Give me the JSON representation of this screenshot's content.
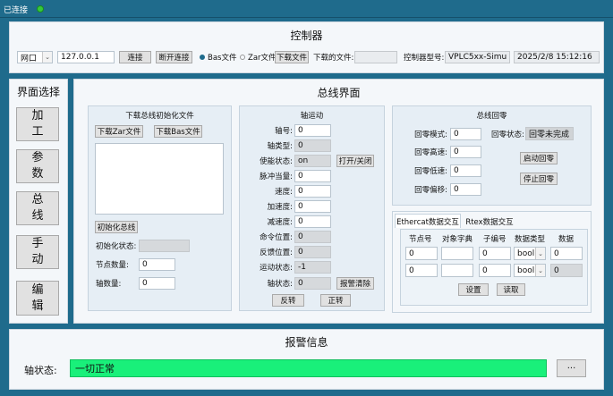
{
  "top": {
    "status": "已连接"
  },
  "controller": {
    "title": "控制器",
    "net_option": "网口",
    "ip": "127.0.0.1",
    "connect": "连接",
    "disconnect": "断开连接",
    "bas_file": "Bas文件",
    "zar_file": "Zar文件",
    "download_file": "下载文件",
    "downloaded_label": "下载的文件:",
    "downloaded_value": "",
    "model_label": "控制器型号:",
    "model_value": "VPLC5xx-Simu",
    "datetime": "2025/2/8 15:12:16"
  },
  "nav": {
    "title": "界面选择",
    "items": [
      "加\n工",
      "参\n数",
      "总\n线",
      "手\n动",
      "编\n辑"
    ]
  },
  "bus": {
    "title": "总线界面",
    "init": {
      "title": "下载总线初始化文件",
      "download_zar": "下载Zar文件",
      "download_bas": "下载Bas文件",
      "init_bus": "初始化总线",
      "init_state_label": "初始化状态:",
      "init_state_value": "",
      "node_count_label": "节点数量:",
      "node_count_value": "0",
      "axis_count_label": "轴数量:",
      "axis_count_value": "0"
    },
    "axis": {
      "title": "轴运动",
      "axis_no_label": "轴号:",
      "axis_no_value": "0",
      "axis_type_label": "轴类型:",
      "axis_type_value": "0",
      "enable_label": "使能状态:",
      "enable_value": "on",
      "toggle": "打开/关闭",
      "pulse_label": "脉冲当量:",
      "pulse_value": "0",
      "speed_label": "速度:",
      "speed_value": "0",
      "accel_label": "加速度:",
      "accel_value": "0",
      "decel_label": "减速度:",
      "decel_value": "0",
      "cmd_pos_label": "命令位置:",
      "cmd_pos_value": "0",
      "fb_pos_label": "反馈位置:",
      "fb_pos_value": "0",
      "motion_label": "运动状态:",
      "motion_value": "-1",
      "axis_state_label": "轴状态:",
      "axis_state_value": "0",
      "clear_alarm": "报警清除",
      "reverse": "反转",
      "forward": "正转"
    },
    "homing": {
      "title": "总线回零",
      "mode_label": "回零模式:",
      "mode_value": "0",
      "state_label": "回零状态:",
      "state_value": "回零未完成",
      "high_label": "回零高速:",
      "high_value": "0",
      "start": "启动回零",
      "low_label": "回零低速:",
      "low_value": "0",
      "stop": "停止回零",
      "offset_label": "回零偏移:",
      "offset_value": "0"
    },
    "tabs": [
      "Ethercat数据交互",
      "Rtex数据交互"
    ],
    "exchange": {
      "headers": [
        "节点号",
        "对象字典",
        "子编号",
        "数据类型",
        "数据"
      ],
      "rows": [
        {
          "node": "0",
          "obj": "",
          "sub": "0",
          "type": "bool",
          "data": "0"
        },
        {
          "node": "0",
          "obj": "",
          "sub": "0",
          "type": "bool",
          "data": "0"
        }
      ],
      "set": "设置",
      "read": "读取"
    }
  },
  "alarm": {
    "title": "报警信息",
    "axis_state_label": "轴状态:",
    "axis_state_value": "一切正常",
    "more": "···"
  },
  "colors": {
    "frame": "#1f6b8c",
    "ok_green": "#19f07a",
    "connected_dot": "#36c93a"
  }
}
